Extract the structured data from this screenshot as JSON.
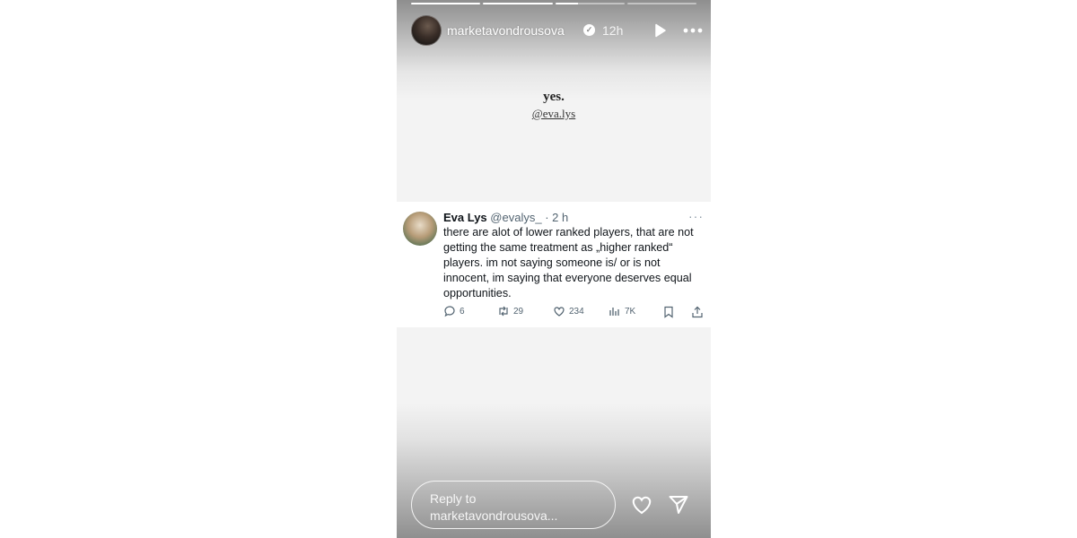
{
  "story": {
    "progress": [
      1,
      1,
      0.33,
      0
    ],
    "username": "marketavondrousova",
    "time": "12h",
    "caption": {
      "line1": "yes.",
      "line2": "@eva.lys"
    },
    "reply_placeholder": "Reply to marketavondrousova..."
  },
  "tweet": {
    "name": "Eva Lys",
    "handle": "@evalys_",
    "time": " · 2 h",
    "dots": "···",
    "text": "there are alot of lower ranked players, that are not getting the same treatment as „higher ranked“ players. im not saying someone is/ or is not innocent, im saying that everyone deserves equal opportunities.",
    "actions": {
      "replies": "6",
      "retweets": "29",
      "likes": "234",
      "views": "7K"
    }
  },
  "icons": {
    "play": "play-icon",
    "more": "more-icon",
    "verified": "verified-badge-icon",
    "reply": "comment-icon",
    "retweet": "retweet-icon",
    "like": "heart-icon",
    "views": "views-icon",
    "bookmark": "bookmark-icon",
    "share": "share-icon",
    "story_like": "heart-icon",
    "send": "send-icon"
  }
}
